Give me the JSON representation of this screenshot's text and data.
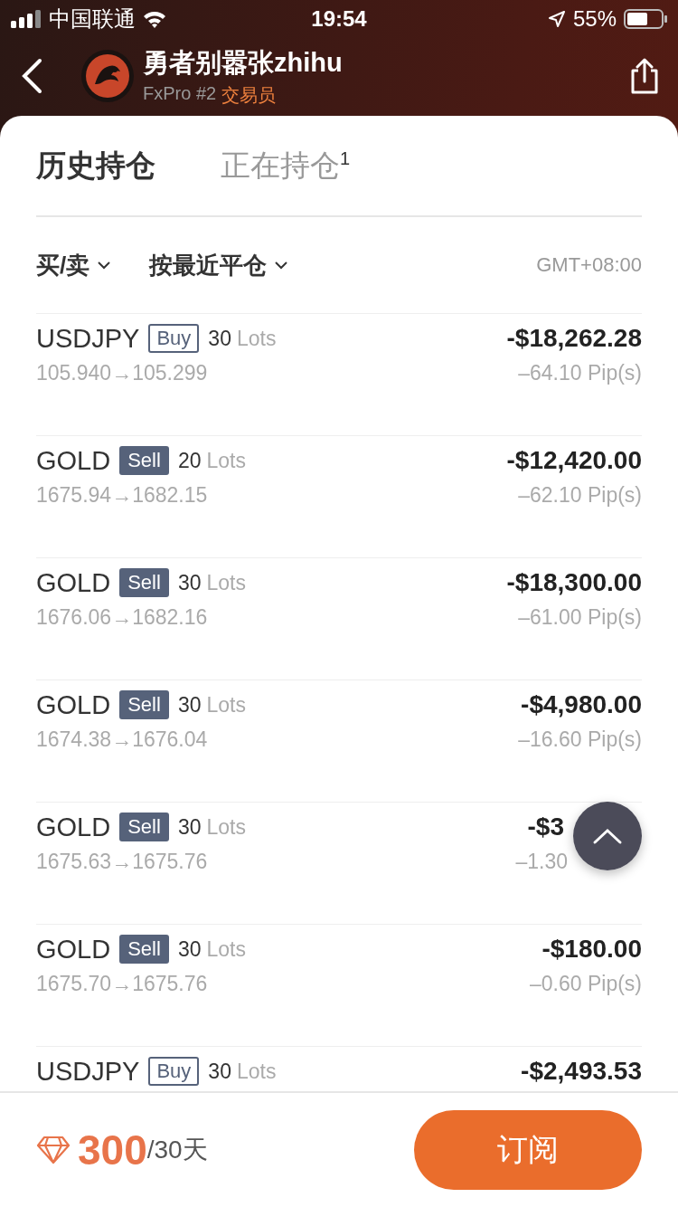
{
  "status_bar": {
    "carrier": "中国联通",
    "time": "19:54",
    "battery": "55%"
  },
  "header": {
    "name": "勇者别嚣张zhihu",
    "broker": "FxPro #2",
    "role": "交易员"
  },
  "tabs": [
    {
      "label": "历史持仓",
      "selected": true
    },
    {
      "label": "正在持仓",
      "selected": false,
      "count": "1"
    }
  ],
  "filters": [
    {
      "label": "买/卖"
    },
    {
      "label": "按最近平仓"
    }
  ],
  "timezone": "GMT+08:00",
  "trades": [
    {
      "symbol": "USDJPY",
      "kind": "buy",
      "side": "Buy",
      "lots": "30",
      "unit": "Lots",
      "prices": "105.940→105.299",
      "profit": "-$18,262.28",
      "pips": "–64.10 Pip(s)"
    },
    {
      "symbol": "GOLD",
      "kind": "sell",
      "side": "Sell",
      "lots": "20",
      "unit": "Lots",
      "prices": "1675.94→1682.15",
      "profit": "-$12,420.00",
      "pips": "–62.10 Pip(s)"
    },
    {
      "symbol": "GOLD",
      "kind": "sell",
      "side": "Sell",
      "lots": "30",
      "unit": "Lots",
      "prices": "1676.06→1682.16",
      "profit": "-$18,300.00",
      "pips": "–61.00 Pip(s)"
    },
    {
      "symbol": "GOLD",
      "kind": "sell",
      "side": "Sell",
      "lots": "30",
      "unit": "Lots",
      "prices": "1674.38→1676.04",
      "profit": "-$4,980.00",
      "pips": "–16.60 Pip(s)"
    },
    {
      "symbol": "GOLD",
      "kind": "sell",
      "side": "Sell",
      "lots": "30",
      "unit": "Lots",
      "prices": "1675.63→1675.76",
      "profit": "-$3",
      "pips": "–1.30",
      "partly_hidden": true
    },
    {
      "symbol": "GOLD",
      "kind": "sell",
      "side": "Sell",
      "lots": "30",
      "unit": "Lots",
      "prices": "1675.70→1675.76",
      "profit": "-$180.00",
      "pips": "–0.60 Pip(s)"
    },
    {
      "symbol": "USDJPY",
      "kind": "buy",
      "side": "Buy",
      "lots": "30",
      "unit": "Lots",
      "profit": "-$2,493.53"
    }
  ],
  "footer": {
    "price": "300",
    "period": "/30天",
    "button": "订阅"
  }
}
